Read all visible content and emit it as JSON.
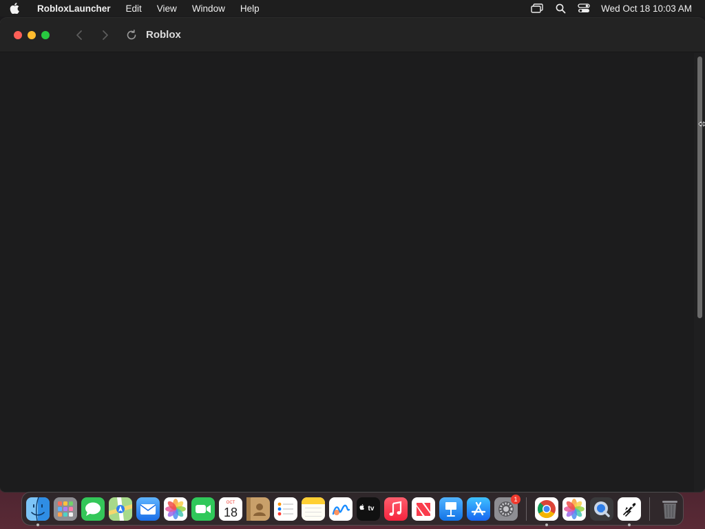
{
  "menubar": {
    "app_name": "RobloxLauncher",
    "menus": [
      "Edit",
      "View",
      "Window",
      "Help"
    ],
    "clock": "Wed Oct 18  10:03 AM",
    "status_icons": [
      "screen-mirroring-icon",
      "spotlight-search-icon",
      "control-center-icon"
    ]
  },
  "window": {
    "title": "Roblox",
    "traffic_lights": {
      "close": "#fe5f57",
      "minimize": "#febc2e",
      "maximize": "#28c840"
    }
  },
  "dock": {
    "apps": [
      {
        "name": "Finder",
        "icon": "finder-icon",
        "running": true
      },
      {
        "name": "Launchpad",
        "icon": "launchpad-icon",
        "running": false
      },
      {
        "name": "Messages",
        "icon": "messages-icon",
        "running": false
      },
      {
        "name": "Maps",
        "icon": "maps-icon",
        "running": false
      },
      {
        "name": "Mail",
        "icon": "mail-icon",
        "running": false
      },
      {
        "name": "Photos",
        "icon": "photos-icon",
        "running": false
      },
      {
        "name": "FaceTime",
        "icon": "facetime-icon",
        "running": false
      },
      {
        "name": "Calendar",
        "icon": "calendar-icon",
        "running": false,
        "month": "OCT",
        "day": "18"
      },
      {
        "name": "Contacts",
        "icon": "contacts-icon",
        "running": false
      },
      {
        "name": "Reminders",
        "icon": "reminders-icon",
        "running": false
      },
      {
        "name": "Notes",
        "icon": "notes-icon",
        "running": false
      },
      {
        "name": "Freeform",
        "icon": "freeform-icon",
        "running": false
      },
      {
        "name": "TV",
        "icon": "apple-tv-icon",
        "running": false,
        "label": "tv"
      },
      {
        "name": "Music",
        "icon": "music-icon",
        "running": false
      },
      {
        "name": "News",
        "icon": "news-icon",
        "running": false
      },
      {
        "name": "Keynote",
        "icon": "keynote-icon",
        "running": false
      },
      {
        "name": "App Store",
        "icon": "app-store-icon",
        "running": false
      },
      {
        "name": "System Settings",
        "icon": "system-settings-icon",
        "running": false,
        "badge": "1"
      }
    ],
    "recent_apps": [
      {
        "name": "Google Chrome",
        "icon": "chrome-icon",
        "running": true
      },
      {
        "name": "Photos",
        "icon": "photos-icon",
        "running": false
      },
      {
        "name": "QuickTime Player",
        "icon": "quicktime-icon",
        "running": false
      },
      {
        "name": "RobloxLauncher",
        "icon": "roblox-launcher-icon",
        "running": true
      }
    ],
    "trash": {
      "name": "Trash",
      "icon": "trash-icon"
    }
  }
}
